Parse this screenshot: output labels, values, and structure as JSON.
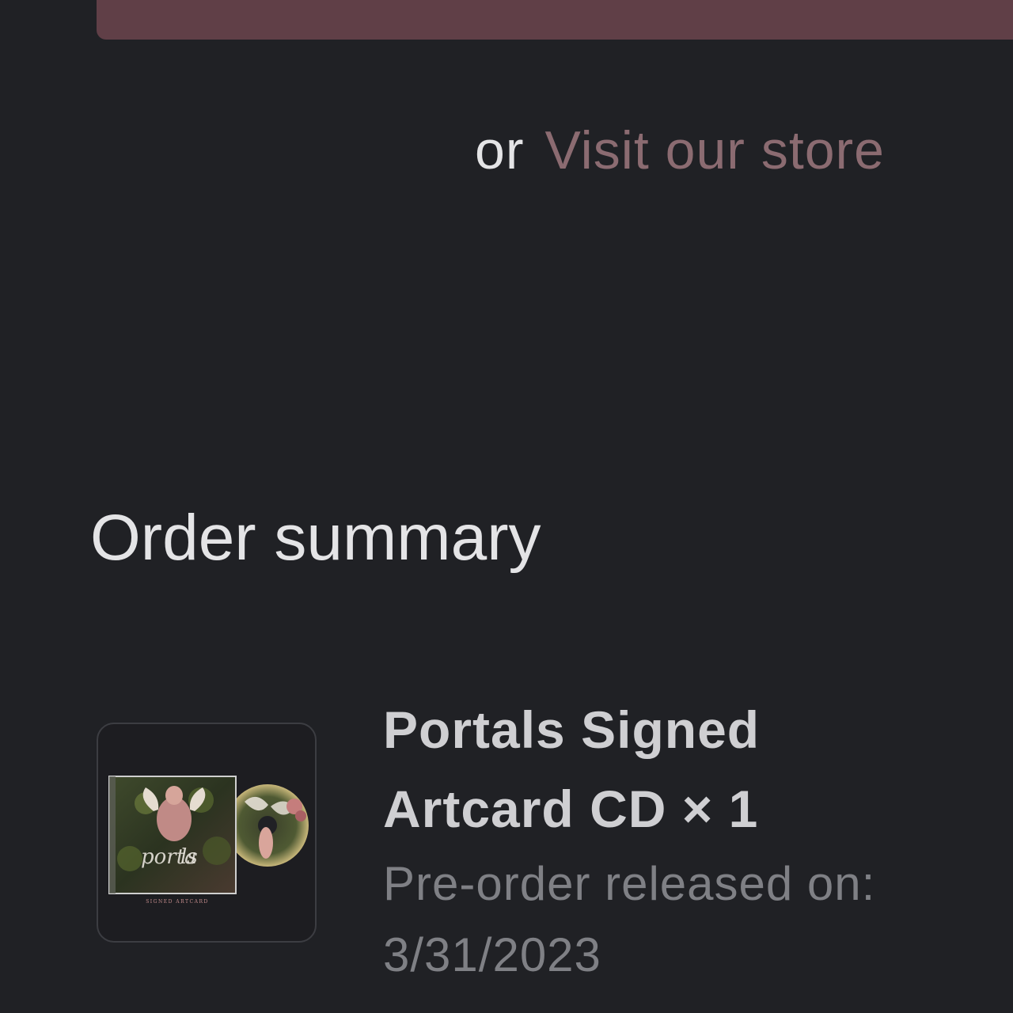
{
  "store_link": {
    "prefix": "or",
    "label": "Visit our store"
  },
  "order_summary": {
    "heading": "Order summary",
    "item": {
      "title_line_1": "Portals Signed",
      "title_line_2": "Artcard CD × 1",
      "note_line_1": "Pre-order released on:",
      "note_line_2": "3/31/2023",
      "image_label": "SIGNED ARTCARD"
    }
  },
  "colors": {
    "background": "#202125",
    "button_fill": "#603f47",
    "link": "#8b6b71",
    "primary_text": "#e4e4e6",
    "secondary_text": "#7f8085"
  }
}
